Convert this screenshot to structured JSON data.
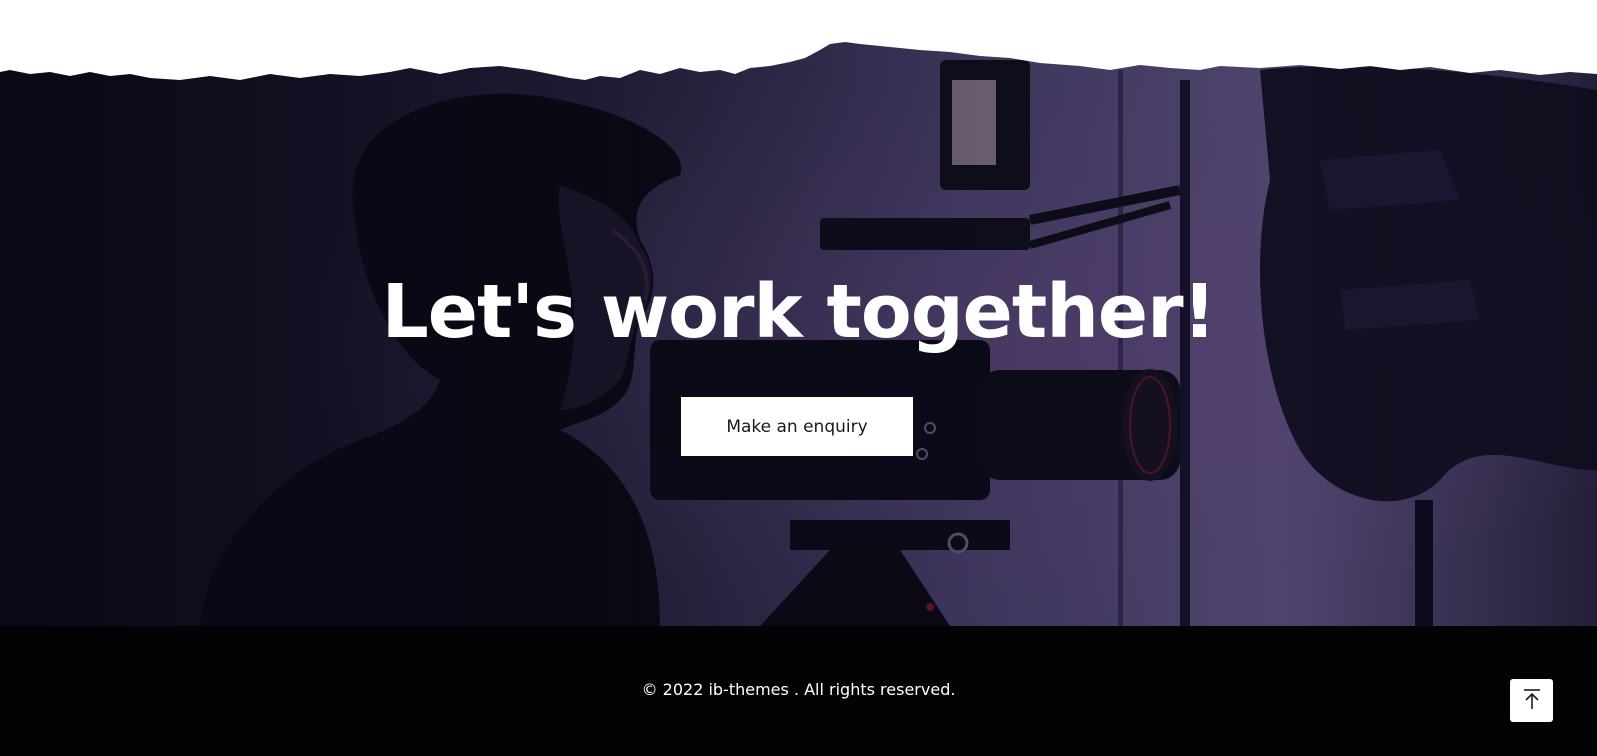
{
  "cta": {
    "title": "Let's work together!",
    "button_label": "Make an enquiry"
  },
  "footer": {
    "copyright": "© 2022 ib-themes . All rights reserved."
  },
  "icons": {
    "back_to_top": "arrow-up-to-line-icon"
  },
  "colors": {
    "overlay_purple": "#4a3e6e",
    "footer_bg": "#030305",
    "button_bg": "#ffffff",
    "title_text": "#ffffff"
  }
}
